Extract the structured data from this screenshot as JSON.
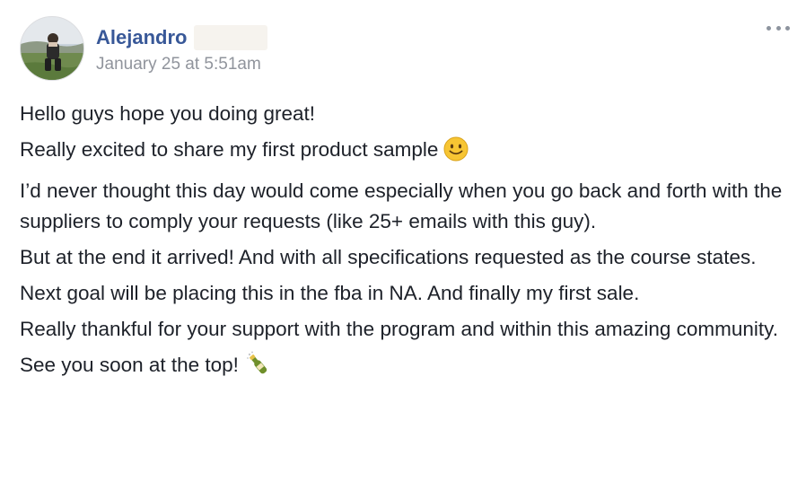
{
  "post": {
    "author": "Alejandro",
    "timestamp": "January 25 at 5:51am",
    "more_icon": "ellipsis-icon",
    "paragraphs": [
      "Hello guys hope you doing great!",
      "Really excited to share my first product sample",
      "I’d never thought this day would come especially when you go back and forth with the suppliers to comply your requests (like 25+ emails with this guy).",
      "But at the end it arrived! And with all specifications requested as the course states.",
      "Next goal will be placing this in the fba in NA. And finally my first sale.",
      "Really thankful for your support with the program and within this amazing community.",
      "See you soon at the top!"
    ],
    "emojis": {
      "smile": "slightly-smiling-face-icon",
      "bottle": "champagne-bottle-icon"
    }
  },
  "colors": {
    "author_link": "#385898",
    "timestamp": "#90949c",
    "text": "#1d2129"
  }
}
